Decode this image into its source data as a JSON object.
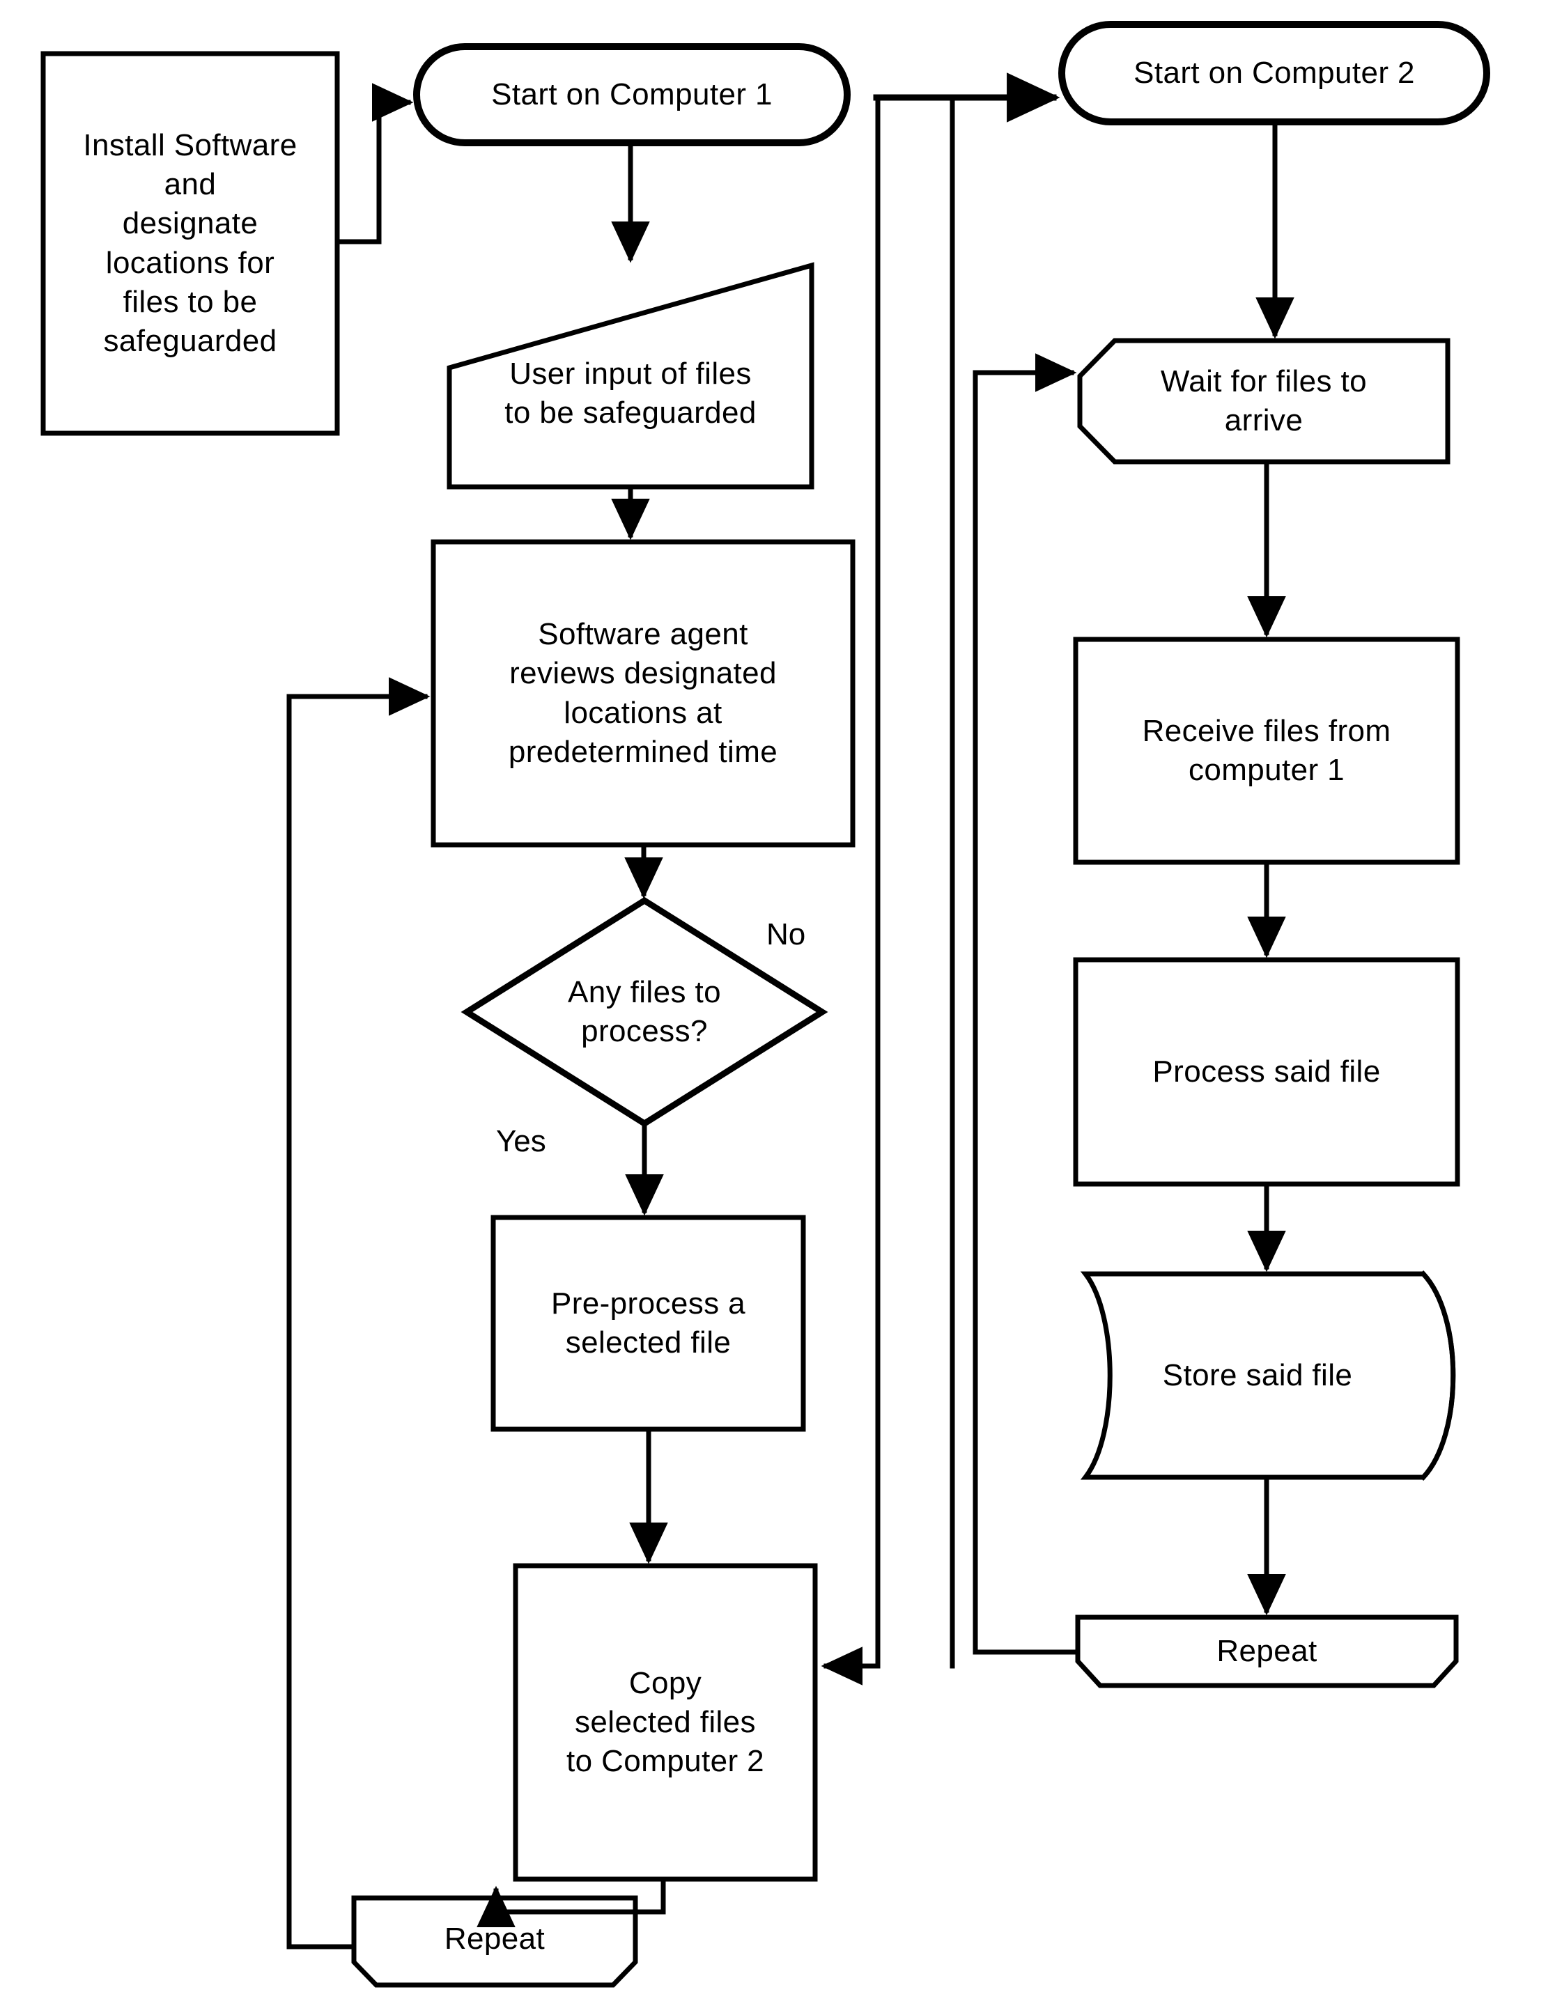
{
  "diagram": {
    "title": "File safeguarding flowchart across two computers",
    "line_color": "#000000",
    "background_color": "#ffffff",
    "text_color": "#000000"
  },
  "nodes": {
    "install": {
      "label": "Install Software\nand\ndesignate\nlocations for\nfiles to be\nsafeguarded",
      "shape": "rectangle"
    },
    "start1": {
      "label": "Start on Computer 1",
      "shape": "stadium"
    },
    "user_input": {
      "label": "User input of files\nto be safeguarded",
      "shape": "manual-input"
    },
    "agent_review": {
      "label": "Software  agent\nreviews designated\nlocations at\npredetermined  time",
      "shape": "rectangle"
    },
    "decision": {
      "label": "Any files to\nprocess?",
      "shape": "diamond"
    },
    "preprocess": {
      "label": "Pre-process a\nselected  file",
      "shape": "rectangle"
    },
    "copy": {
      "label": "Copy\nselected  files\nto Computer 2",
      "shape": "rectangle"
    },
    "repeat_left": {
      "label": "Repeat",
      "shape": "chamfered-bottom"
    },
    "start2": {
      "label": "Start on Computer 2",
      "shape": "stadium"
    },
    "wait": {
      "label": "Wait for files to\narrive",
      "shape": "chamfered-left"
    },
    "receive": {
      "label": "Receive files from\ncomputer 1",
      "shape": "rectangle"
    },
    "process": {
      "label": "Process said file",
      "shape": "rectangle"
    },
    "store": {
      "label": "Store said file",
      "shape": "cylinder"
    },
    "repeat_right": {
      "label": "Repeat",
      "shape": "chamfered-bottom"
    }
  },
  "edge_labels": {
    "no": "No",
    "yes": "Yes"
  }
}
